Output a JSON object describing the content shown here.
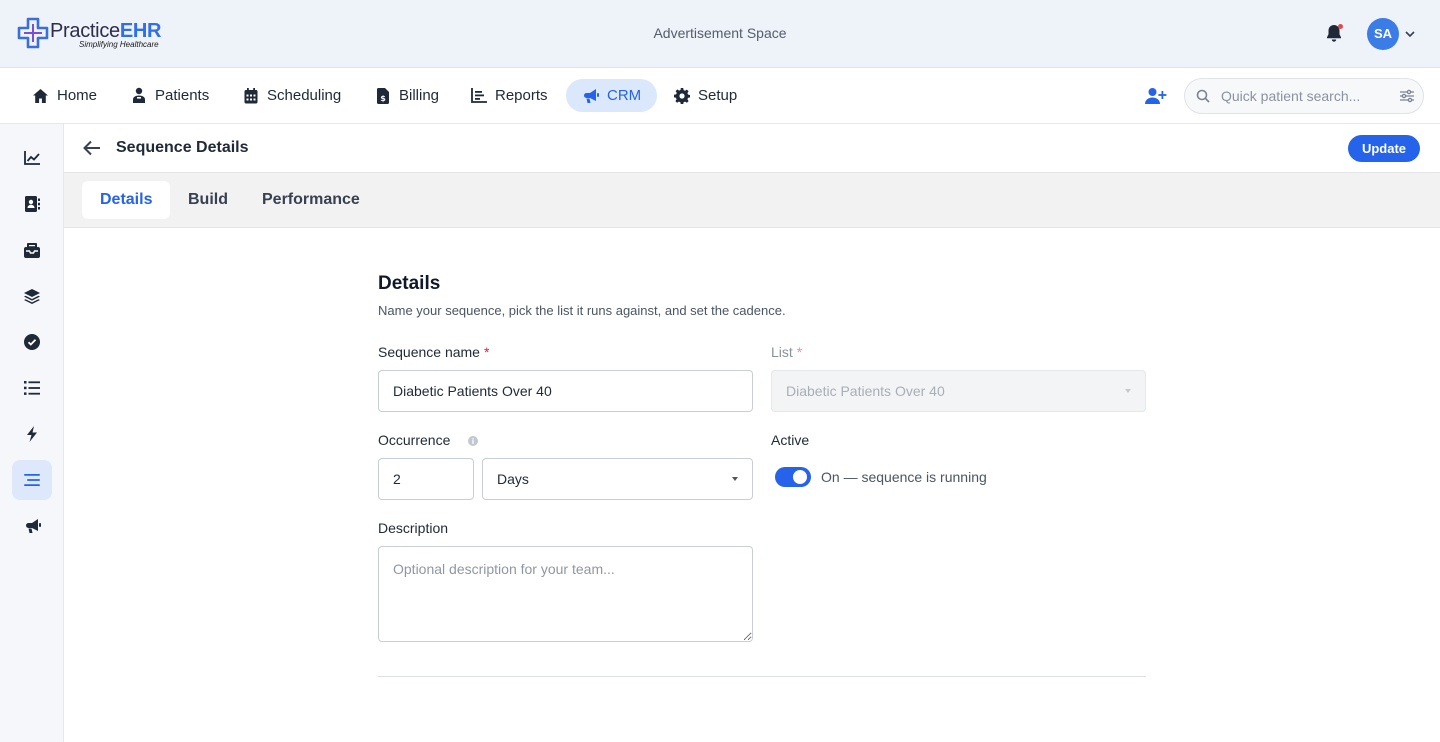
{
  "header": {
    "logo_name_part1": "Practice",
    "logo_name_part2": "EHR",
    "logo_tagline": "Simplifying Healthcare",
    "ad_space": "Advertisement Space",
    "avatar_initials": "SA"
  },
  "nav": {
    "items": [
      {
        "label": "Home",
        "icon": "home-icon"
      },
      {
        "label": "Patients",
        "icon": "patient-icon"
      },
      {
        "label": "Scheduling",
        "icon": "calendar-icon"
      },
      {
        "label": "Billing",
        "icon": "invoice-icon"
      },
      {
        "label": "Reports",
        "icon": "report-icon"
      },
      {
        "label": "CRM",
        "icon": "megaphone-icon",
        "active": true
      },
      {
        "label": "Setup",
        "icon": "gear-icon"
      }
    ],
    "search_placeholder": "Quick patient search..."
  },
  "siderail": {
    "items": [
      {
        "icon": "chart-line-icon"
      },
      {
        "icon": "contact-book-icon"
      },
      {
        "icon": "inbox-icon"
      },
      {
        "icon": "layers-icon"
      },
      {
        "icon": "check-circle-icon"
      },
      {
        "icon": "list-icon"
      },
      {
        "icon": "bolt-icon"
      },
      {
        "icon": "sequence-icon",
        "active": true
      },
      {
        "icon": "megaphone-icon"
      }
    ]
  },
  "page": {
    "title": "Sequence Details",
    "update_label": "Update"
  },
  "tabs": [
    {
      "label": "Details",
      "active": true
    },
    {
      "label": "Build"
    },
    {
      "label": "Performance"
    }
  ],
  "form": {
    "section_title": "Details",
    "section_subtitle": "Name your sequence, pick the list it runs against, and set the cadence.",
    "sequence_name_label": "Sequence name",
    "required_mark": "*",
    "sequence_name_value": "Diabetic Patients Over 40",
    "list_label": "List",
    "list_value": "Diabetic Patients Over 40",
    "occurrence_label": "Occurrence",
    "occurrence_value": "2",
    "occurrence_unit": "Days",
    "active_label": "Active",
    "active_on": true,
    "active_status_text": "On — sequence is running",
    "description_label": "Description",
    "description_placeholder": "Optional description for your team..."
  },
  "colors": {
    "accent": "#2563eb",
    "required": "#e11d48",
    "notification_dot": "#e5484d"
  }
}
